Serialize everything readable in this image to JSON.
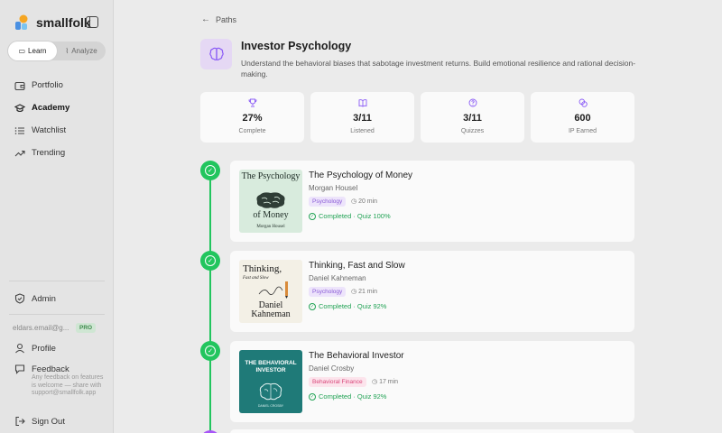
{
  "app": {
    "name": "smallfolk"
  },
  "mode_switch": {
    "learn": "Learn",
    "analyze": "Analyze"
  },
  "nav": {
    "portfolio": "Portfolio",
    "academy": "Academy",
    "watchlist": "Watchlist",
    "trending": "Trending"
  },
  "sidebar_bottom": {
    "admin": "Admin",
    "email": "eldars.email@g...",
    "badge": "PRO",
    "profile": "Profile",
    "feedback": "Feedback",
    "feedback_note": "Any feedback on features is welcome — share with support@smallfolk.app",
    "sign_out": "Sign Out"
  },
  "back_link": "Paths",
  "path": {
    "title": "Investor Psychology",
    "description": "Understand the behavioral biases that sabotage investment returns. Build emotional resilience and rational decision-making."
  },
  "stats": [
    {
      "value": "27%",
      "label": "Complete",
      "icon": "trophy-icon"
    },
    {
      "value": "3/11",
      "label": "Listened",
      "icon": "book-icon"
    },
    {
      "value": "3/11",
      "label": "Quizzes",
      "icon": "question-icon"
    },
    {
      "value": "600",
      "label": "IP Earned",
      "icon": "coins-icon"
    }
  ],
  "books": [
    {
      "title": "The Psychology of Money",
      "author": "Morgan Housel",
      "tag": "Psychology",
      "duration": "20 min",
      "status": "Completed · Quiz 100%",
      "cover": {
        "line1": "The Psychology",
        "line2": "of Money",
        "line3": "Morgan Housel"
      }
    },
    {
      "title": "Thinking, Fast and Slow",
      "author": "Daniel Kahneman",
      "tag": "Psychology",
      "duration": "21 min",
      "status": "Completed · Quiz 92%",
      "cover": {
        "line1": "Thinking,",
        "line2": "Fast and Slow",
        "line3": "Daniel Kahneman"
      }
    },
    {
      "title": "The Behavioral Investor",
      "author": "Daniel Crosby",
      "tag": "Behavioral Finance",
      "duration": "17 min",
      "status": "Completed · Quiz 92%",
      "cover": {
        "line1": "THE BEHAVIORAL INVESTOR",
        "line2": "DANIEL CROSBY"
      }
    }
  ],
  "colors": {
    "accent": "#8b5cf6",
    "success": "#22c55e",
    "sidebar": "#e4e4e4"
  }
}
